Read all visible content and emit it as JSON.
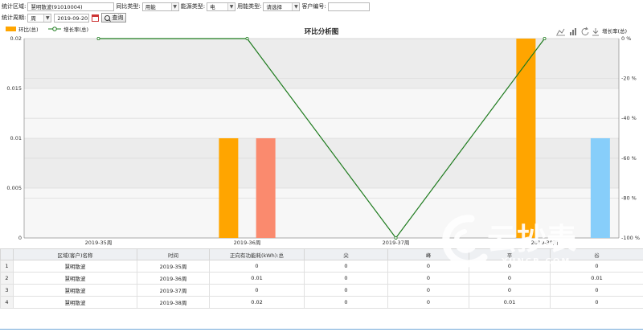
{
  "filters": {
    "region_label": "统计区域:",
    "region_value": "慧明散波(91010004)",
    "compare_type_label": "同比类型:",
    "compare_type_value": "用能",
    "energy_type_label": "能源类型:",
    "energy_type_value": "电",
    "usage_type_label": "用能类型:",
    "usage_type_value": "请选择",
    "customer_no_label": "客户编号:",
    "customer_no_value": "",
    "period_label": "统计周期:",
    "period_value": "周",
    "date_value": "2019-09-20",
    "query_label": "查询"
  },
  "chart_toolbar": {
    "line_icon": "line-chart-icon",
    "bar_icon": "bar-chart-icon",
    "refresh_icon": "refresh-icon",
    "download_icon": "download-icon",
    "series_toggle_label": "增长率(总)"
  },
  "chart_data": {
    "type": "bar",
    "title": "环比分析图",
    "legend_position": "top-left",
    "categories": [
      "2019-35周",
      "2019-36周",
      "2019-37周",
      "2019-38周"
    ],
    "y_left": {
      "min": 0,
      "max": 0.02,
      "ticks": [
        "0",
        "0.005",
        "0.01",
        "0.015",
        "0.02"
      ]
    },
    "y_right": {
      "min": -100,
      "max": 0,
      "ticks": [
        "0 %",
        "-20 %",
        "-40 %",
        "-60 %",
        "-80 %",
        "-100 %"
      ]
    },
    "bar_series": [
      {
        "name": "环比(总)",
        "color": "#FFA500",
        "values": [
          0,
          0.01,
          0,
          0.02
        ]
      },
      {
        "name": "",
        "color": "#FA8A6E",
        "values": [
          0,
          0.01,
          0,
          0
        ]
      },
      {
        "name": "",
        "color": "#87CEFA",
        "values": [
          0,
          0,
          0,
          0.01
        ]
      }
    ],
    "line_series": {
      "name": "增长率(总)",
      "color": "#1E7B1E",
      "values": [
        0,
        0,
        -100,
        0
      ]
    },
    "grid": true
  },
  "table": {
    "headers": [
      "",
      "区域(客户)名称",
      "时间",
      "正向有功能耗(kWh):总",
      "尖",
      "峰",
      "平",
      "谷"
    ],
    "rows": [
      [
        "1",
        "慧明散波",
        "2019-35周",
        "0",
        "0",
        "0",
        "0",
        "0"
      ],
      [
        "2",
        "慧明散波",
        "2019-36周",
        "0.01",
        "0",
        "0",
        "0",
        "0.01"
      ],
      [
        "3",
        "慧明散波",
        "2019-37周",
        "0",
        "0",
        "0",
        "0",
        "0"
      ],
      [
        "4",
        "慧明散波",
        "2019-38周",
        "0.02",
        "0",
        "0",
        "0.01",
        "0"
      ]
    ]
  },
  "watermark": {
    "text": "云抄表",
    "subtext": "YUNCB.COM"
  }
}
